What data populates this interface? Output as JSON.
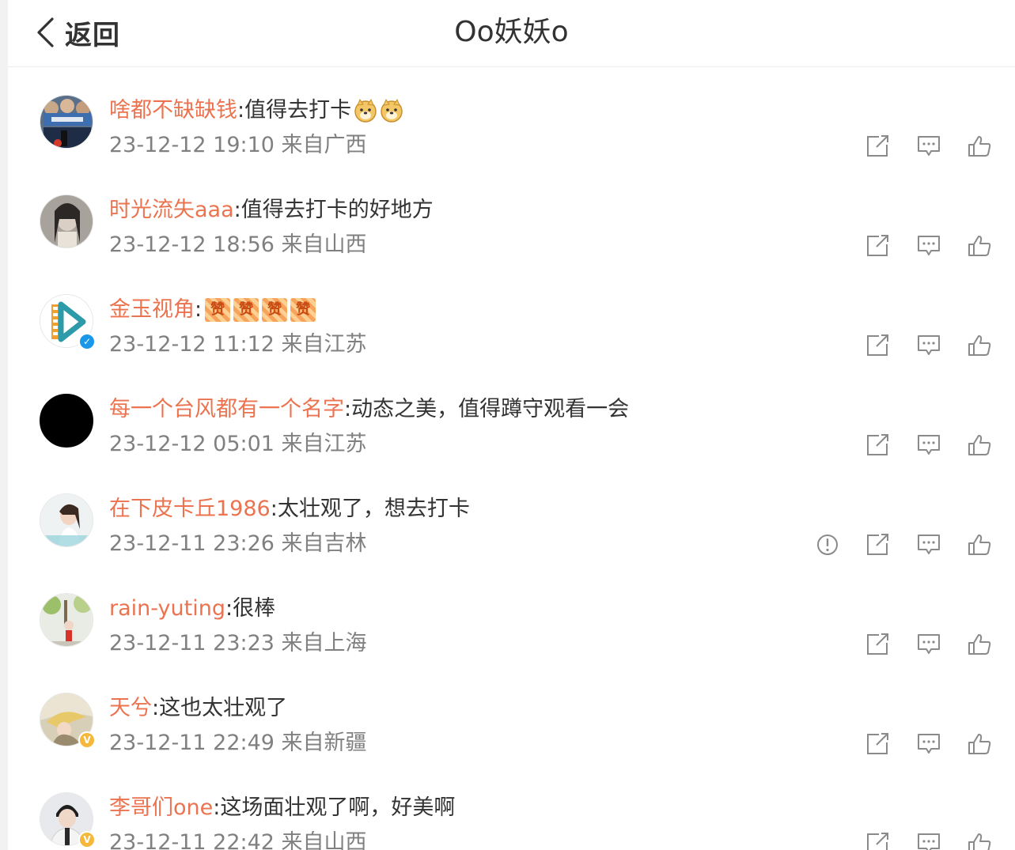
{
  "header": {
    "back_label": "返回",
    "title": "Oo妖妖o"
  },
  "colors": {
    "username": "#eb7350",
    "timestamp": "#808080",
    "text": "#333333",
    "icon": "#8a8a8a"
  },
  "comments": [
    {
      "user": "啥都不缺缺钱",
      "text": ":值得去打卡",
      "emojis": [
        "doge-emoji",
        "doge-emoji"
      ],
      "time": "23-12-12 19:10 来自广西",
      "badge": null,
      "report": false
    },
    {
      "user": "时光流失aaa",
      "text": ":值得去打卡的好地方",
      "emojis": [],
      "time": "23-12-12 18:56 来自山西",
      "badge": null,
      "report": false
    },
    {
      "user": "金玉视角",
      "text": ":",
      "emojis": [
        "赞",
        "赞",
        "赞",
        "赞"
      ],
      "time": "23-12-12 11:12 来自江苏",
      "badge": "blue",
      "report": false
    },
    {
      "user": "每一个台风都有一个名字",
      "text": ":动态之美，值得蹲守观看一会",
      "emojis": [],
      "time": "23-12-12 05:01 来自江苏",
      "badge": null,
      "report": false
    },
    {
      "user": "在下皮卡丘1986",
      "text": ":太壮观了，想去打卡",
      "emojis": [],
      "time": "23-12-11 23:26 来自吉林",
      "badge": null,
      "report": true
    },
    {
      "user": "rain-yuting",
      "text": ":很棒",
      "emojis": [],
      "time": "23-12-11 23:23 来自上海",
      "badge": null,
      "report": false
    },
    {
      "user": "天兮",
      "text": ":这也太壮观了",
      "emojis": [],
      "time": "23-12-11 22:49 来自新疆",
      "badge": "gold",
      "report": false
    },
    {
      "user": "李哥们one",
      "text": ":这场面壮观了啊，好美啊",
      "emojis": [],
      "time": "23-12-11 22:42 来自山西",
      "badge": "gold",
      "report": false
    }
  ]
}
